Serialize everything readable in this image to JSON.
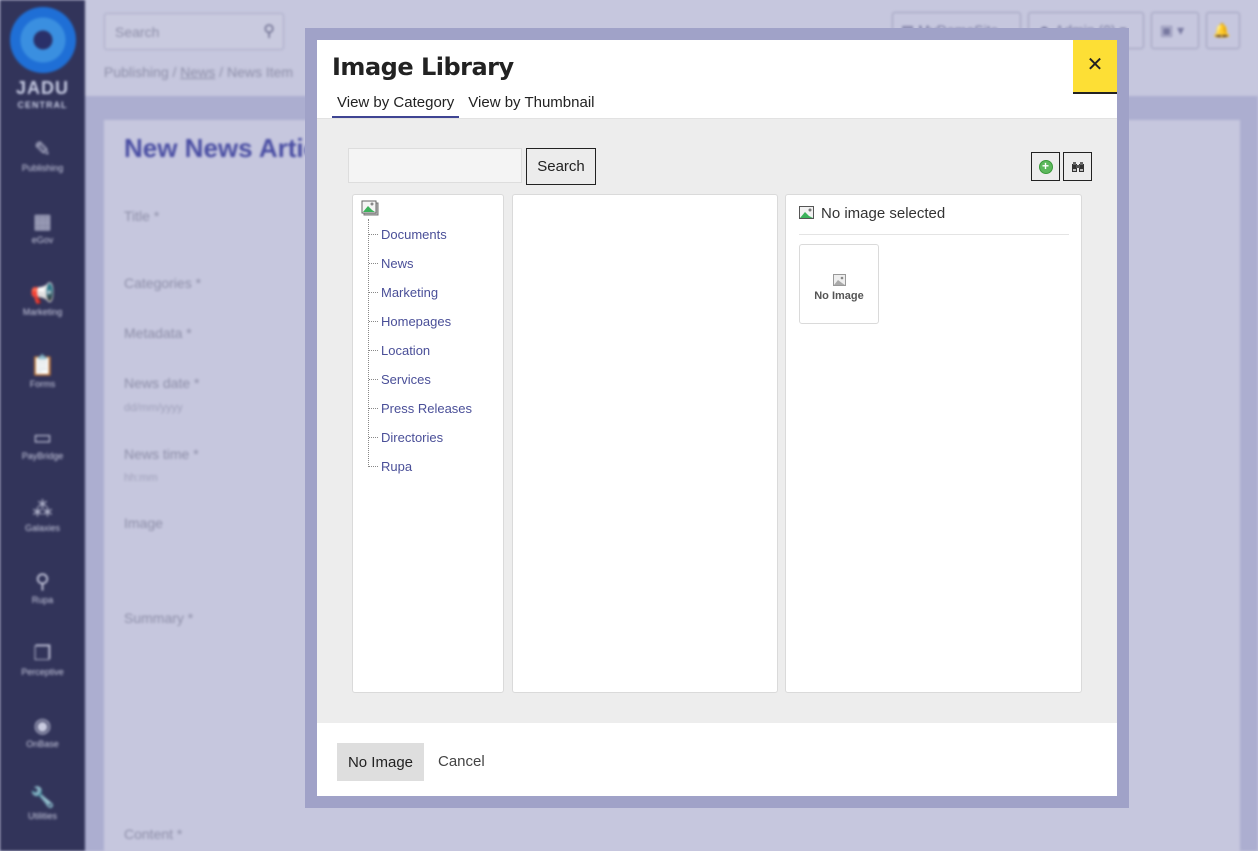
{
  "app": {
    "logo": {
      "line1": "JADU",
      "line2": "CENTRAL"
    },
    "sidebar": [
      {
        "label": "Publishing",
        "icon": "pencil-icon",
        "glyph": "✎"
      },
      {
        "label": "eGov",
        "icon": "building-icon",
        "glyph": "▦"
      },
      {
        "label": "Marketing",
        "icon": "megaphone-icon",
        "glyph": "📢"
      },
      {
        "label": "Forms",
        "icon": "clipboard-icon",
        "glyph": "📋"
      },
      {
        "label": "PayBridge",
        "icon": "credit-card-icon",
        "glyph": "▭"
      },
      {
        "label": "Galaxies",
        "icon": "sitemap-icon",
        "glyph": "⁂"
      },
      {
        "label": "Rupa",
        "icon": "search-icon",
        "glyph": "⚲"
      },
      {
        "label": "Perceptive",
        "icon": "documents-icon",
        "glyph": "❐"
      },
      {
        "label": "OnBase",
        "icon": "play-circle-icon",
        "glyph": "◉"
      },
      {
        "label": "Utilities",
        "icon": "wrench-icon",
        "glyph": "🔧"
      }
    ],
    "topbar": {
      "search_placeholder": "Search",
      "site_button": "MyDemoSite",
      "user_button": "Admin (0)",
      "apps_button": "▾",
      "notifications_button": "🔔"
    },
    "breadcrumb": {
      "root": "Publishing",
      "sep": " / ",
      "section": "News",
      "current": "News Item"
    },
    "page": {
      "title": "New News Article",
      "fields": [
        {
          "label": "Title *"
        },
        {
          "label": "Categories *"
        },
        {
          "label": "Metadata *"
        },
        {
          "label": "News date *",
          "hint": "dd/mm/yyyy"
        },
        {
          "label": "News time *",
          "hint": "hh:mm"
        },
        {
          "label": "Image"
        },
        {
          "label": "Summary *"
        },
        {
          "label": "Content *"
        }
      ]
    }
  },
  "modal": {
    "title": "Image Library",
    "close_label": "✕",
    "tabs": [
      {
        "label": "View by Category",
        "active": true
      },
      {
        "label": "View by Thumbnail",
        "active": false
      }
    ],
    "search": {
      "value": "",
      "placeholder": "",
      "button_label": "Search"
    },
    "toolbar": {
      "add_title": "Add image",
      "find_title": "Find"
    },
    "categories": [
      "Documents",
      "News",
      "Marketing",
      "Homepages",
      "Location",
      "Services",
      "Press Releases",
      "Directories",
      "Rupa"
    ],
    "preview": {
      "heading": "No image selected",
      "thumb_label": "No Image"
    },
    "footer": {
      "no_image_label": "No Image",
      "cancel_label": "Cancel"
    }
  },
  "colors": {
    "sidebar_bg": "#32345a",
    "accent": "#3f4593",
    "close_button": "#fddf35",
    "link": "#4a4f98"
  }
}
